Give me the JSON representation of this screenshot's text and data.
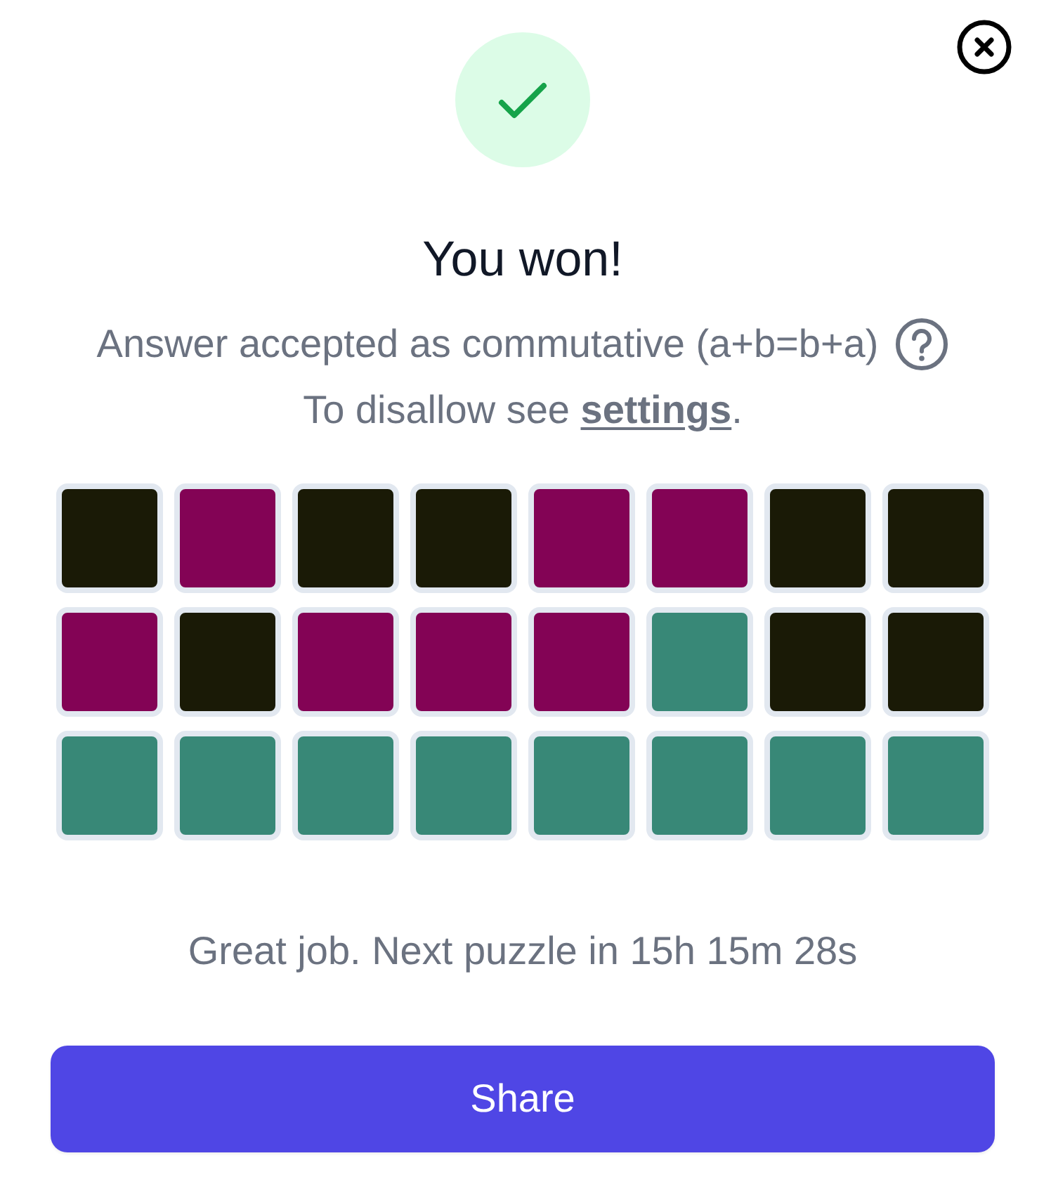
{
  "title": "You won!",
  "message": "Answer accepted as commutative (a+b=b+a)",
  "hint": {
    "before": "To disallow see ",
    "link": "settings",
    "after": "."
  },
  "grid": {
    "rows": [
      {
        "tiles": [
          {
            "color": "#1a1a06"
          },
          {
            "color": "#830355"
          },
          {
            "color": "#1a1a06"
          },
          {
            "color": "#1a1a06"
          },
          {
            "color": "#830355"
          },
          {
            "color": "#830355"
          },
          {
            "color": "#1a1a06"
          },
          {
            "color": "#1a1a06"
          }
        ]
      },
      {
        "tiles": [
          {
            "color": "#830355"
          },
          {
            "color": "#1a1a06"
          },
          {
            "color": "#830355"
          },
          {
            "color": "#830355"
          },
          {
            "color": "#830355"
          },
          {
            "color": "#388877"
          },
          {
            "color": "#1a1a06"
          },
          {
            "color": "#1a1a06"
          }
        ]
      },
      {
        "tiles": [
          {
            "color": "#388877"
          },
          {
            "color": "#388877"
          },
          {
            "color": "#388877"
          },
          {
            "color": "#388877"
          },
          {
            "color": "#388877"
          },
          {
            "color": "#388877"
          },
          {
            "color": "#388877"
          },
          {
            "color": "#388877"
          }
        ]
      }
    ]
  },
  "footer": "Great job. Next puzzle in 15h 15m 28s",
  "share_button": "Share"
}
